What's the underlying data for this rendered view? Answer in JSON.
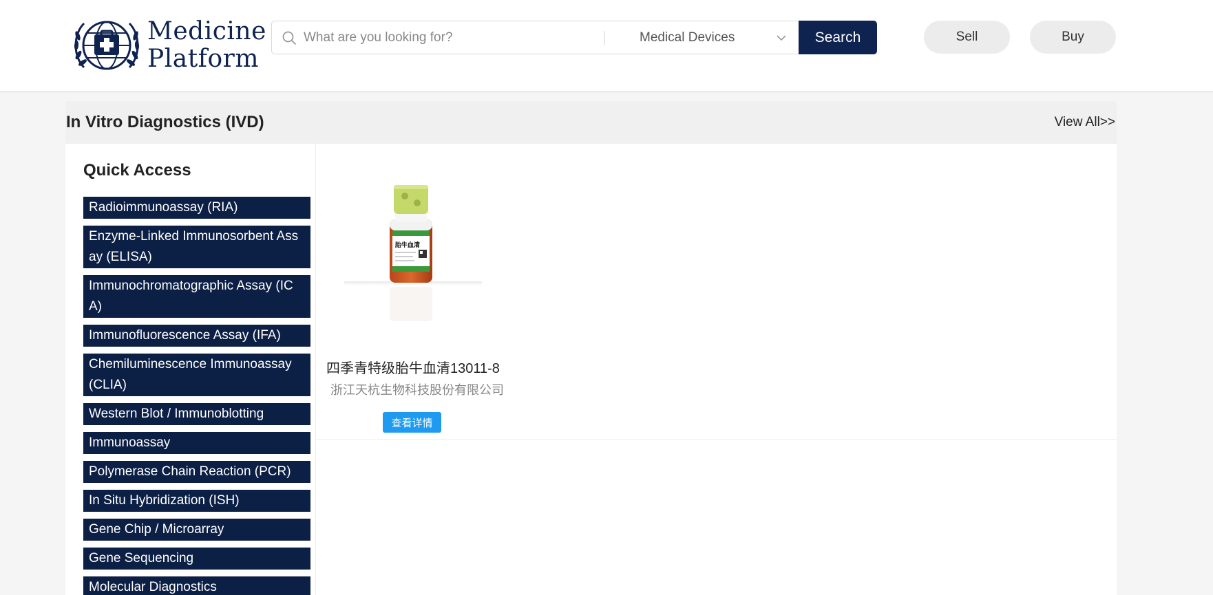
{
  "brand": {
    "line1": "Medicine",
    "line2": "Platform",
    "color": "#0f2350"
  },
  "search": {
    "placeholder": "What are you looking for?",
    "value": "",
    "category": "Medical Devices",
    "button_label": "Search",
    "icon": "search-icon"
  },
  "actions": {
    "sell_label": "Sell",
    "buy_label": "Buy"
  },
  "section": {
    "title": "In Vitro Diagnostics (IVD)",
    "view_all_label": "View All>>"
  },
  "quick_access": {
    "title": "Quick Access",
    "items": [
      "Radioimmunoassay (RIA)",
      "Enzyme-Linked Immunosorbent Assay (ELISA)",
      "Immunochromatographic Assay  (ICA)",
      "Immunofluorescence Assay (IFA)",
      "Chemiluminescence Immunoassay (CLIA)",
      "Western Blot / Immunoblotting",
      "Immunoassay",
      "Polymerase Chain Reaction (PCR)",
      "In Situ Hybridization (ISH)",
      "Gene Chip / Microarray",
      "Gene Sequencing",
      "Molecular Diagnostics"
    ]
  },
  "products": [
    {
      "name": "四季青特级胎牛血清13011-8",
      "company": "浙江天杭生物科技股份有限公司",
      "detail_label": "查看详情",
      "image_label": "胎牛血清"
    }
  ],
  "colors": {
    "navy": "#0c1f45",
    "accent_blue": "#1e9bf0",
    "pill_bg": "#ececec"
  }
}
